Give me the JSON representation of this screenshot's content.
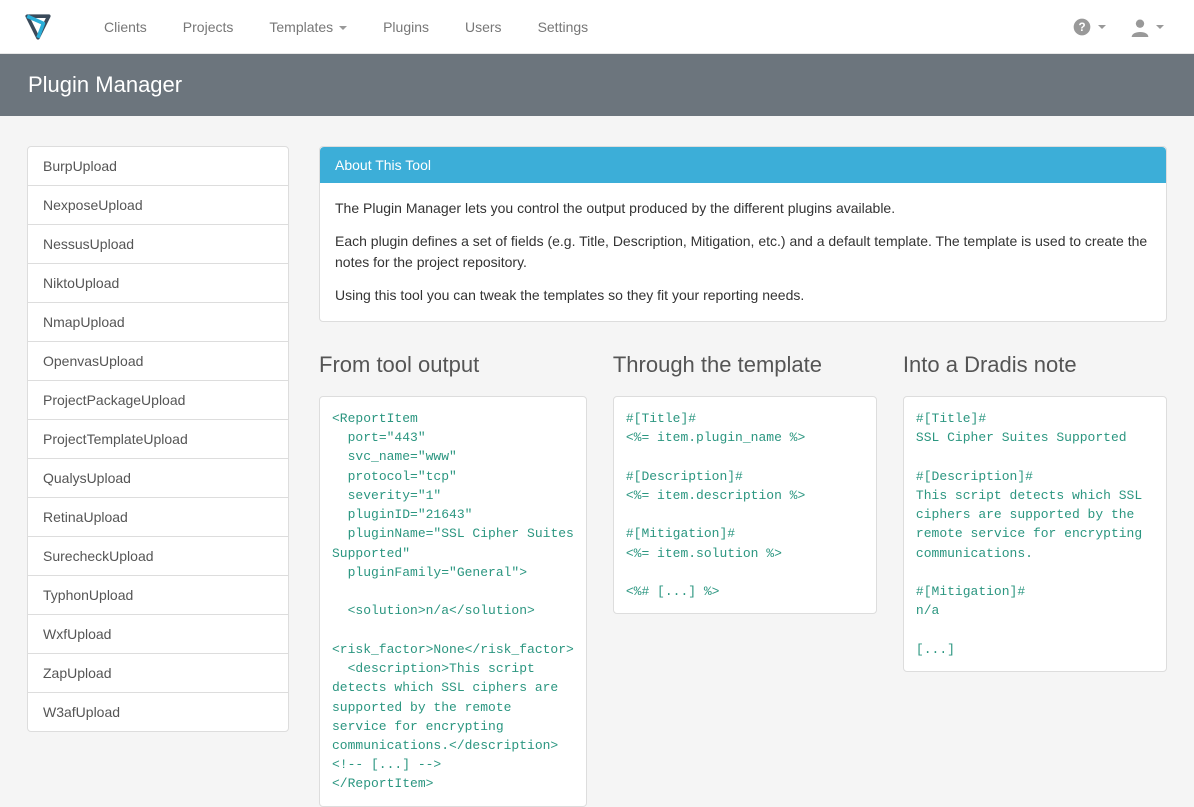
{
  "nav": {
    "items": [
      {
        "label": "Clients"
      },
      {
        "label": "Projects"
      },
      {
        "label": "Templates",
        "dropdown": true
      },
      {
        "label": "Plugins"
      },
      {
        "label": "Users"
      },
      {
        "label": "Settings"
      }
    ]
  },
  "page_title": "Plugin Manager",
  "sidebar": {
    "items": [
      "BurpUpload",
      "NexposeUpload",
      "NessusUpload",
      "NiktoUpload",
      "NmapUpload",
      "OpenvasUpload",
      "ProjectPackageUpload",
      "ProjectTemplateUpload",
      "QualysUpload",
      "RetinaUpload",
      "SurecheckUpload",
      "TyphonUpload",
      "WxfUpload",
      "ZapUpload",
      "W3afUpload"
    ]
  },
  "about": {
    "heading": "About This Tool",
    "p1": "The Plugin Manager lets you control the output produced by the different plugins available.",
    "p2": "Each plugin defines a set of fields (e.g. Title, Description, Mitigation, etc.) and a default template. The template is used to create the notes for the project repository.",
    "p3": "Using this tool you can tweak the templates so they fit your reporting needs."
  },
  "columns": {
    "col1": {
      "heading": "From tool output",
      "code": "<ReportItem\n  port=\"443\"\n  svc_name=\"www\"\n  protocol=\"tcp\"\n  severity=\"1\"\n  pluginID=\"21643\"\n  pluginName=\"SSL Cipher Suites Supported\"\n  pluginFamily=\"General\">\n\n  <solution>n/a</solution>\n  <risk_factor>None</risk_factor>\n  <description>This script detects which SSL ciphers are supported by the remote\nservice for encrypting communications.</description>\n<!-- [...] -->\n</ReportItem>"
    },
    "col2": {
      "heading": "Through the template",
      "code": "#[Title]#\n<%= item.plugin_name %>\n\n#[Description]#\n<%= item.description %>\n\n#[Mitigation]#\n<%= item.solution %>\n\n<%# [...] %>"
    },
    "col3": {
      "heading": "Into a Dradis note",
      "code": "#[Title]#\nSSL Cipher Suites Supported\n\n#[Description]#\nThis script detects which SSL ciphers are supported by the remote service for encrypting communications.\n\n#[Mitigation]#\nn/a\n\n[...]"
    }
  }
}
